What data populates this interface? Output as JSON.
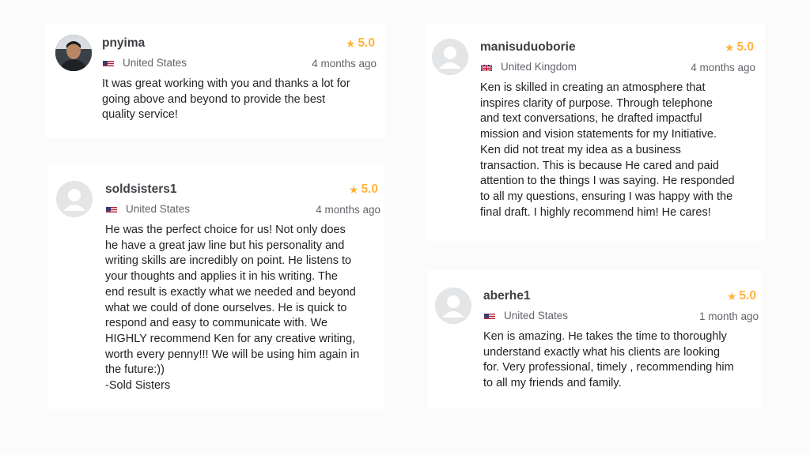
{
  "reviews": [
    {
      "username": "pnyima",
      "rating": "5.0",
      "country": "United States",
      "time": "4 months ago",
      "text": "It was great working with you and thanks a lot for\ngoing above and beyond to provide the best\nquality service!",
      "avatar": "photo",
      "flag": "us-flag-icon"
    },
    {
      "username": "manisuduoborie",
      "rating": "5.0",
      "country": "United Kingdom",
      "time": "4 months ago",
      "text": "Ken is skilled in creating an atmosphere that\ninspires clarity of purpose. Through telephone\nand text conversations, he drafted impactful\nmission and vision statements for my Initiative.\nKen did not treat my idea as a business\ntransaction. This is because He cared and paid\nattention to the things I was saying. He responded\nto all my questions, ensuring I was happy with the\nfinal draft. I highly recommend him! He cares!",
      "avatar": "default",
      "flag": "uk-flag-icon"
    },
    {
      "username": "soldsisters1",
      "rating": "5.0",
      "country": "United States",
      "time": "4 months ago",
      "text": "He was the perfect choice for us! Not only does\nhe have a great jaw line but his personality and\nwriting skills are incredibly on point. He listens to\nyour thoughts and applies it in his writing. The\nend result is exactly what we needed and beyond\nwhat we could of done ourselves. He is quick to\nrespond and easy to communicate with. We\nHIGHLY recommend Ken for any creative writing,\nworth every penny!!! We will be using him again in\nthe future:))\n-Sold Sisters",
      "avatar": "default",
      "flag": "us-flag-icon"
    },
    {
      "username": "aberhe1",
      "rating": "5.0",
      "country": "United States",
      "time": "1 month ago",
      "text": "Ken is amazing. He takes the time to thoroughly\nunderstand exactly what his clients are looking\nfor. Very professional, timely , recommending him\nto all my friends and family.",
      "avatar": "default",
      "flag": "us-flag-icon"
    }
  ],
  "colors": {
    "star": "#ffb33e",
    "username": "#404145",
    "meta": "#62646a",
    "body": "#222325",
    "avatar_placeholder": "#e4e5e7"
  },
  "icons": {
    "star": "★"
  }
}
